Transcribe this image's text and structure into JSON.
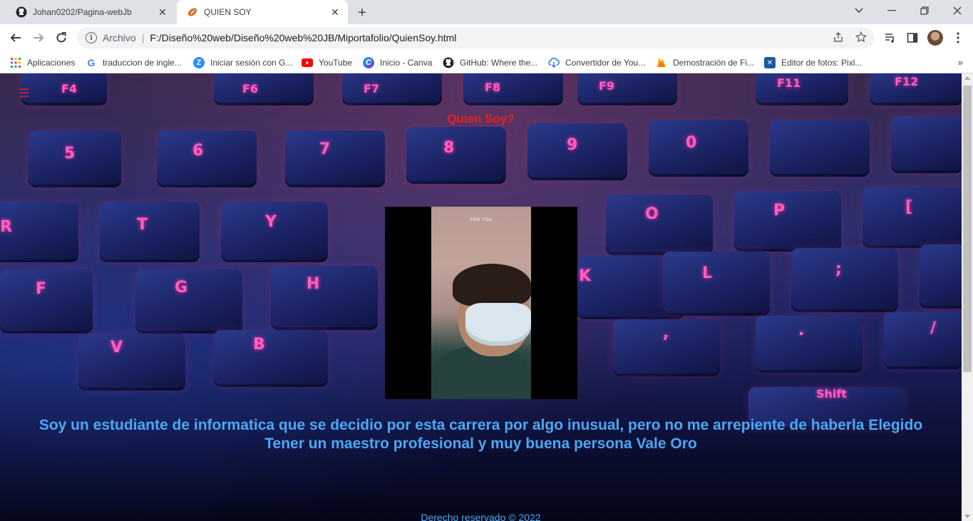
{
  "browser": {
    "tabs": [
      {
        "title": "Johan0202/Pagina-webJb",
        "icon": "github-icon",
        "active": false
      },
      {
        "title": "QUIEN SOY",
        "icon": "football-icon",
        "active": true
      }
    ],
    "new_tab_label": "+",
    "address": {
      "scheme_label": "Archivo",
      "separator": "|",
      "url": "F:/Diseño%20web/Diseño%20web%20JB/Miportafolio/QuienSoy.html"
    },
    "bookmarks": [
      {
        "label": "Aplicaciones",
        "icon": "apps-grid-icon"
      },
      {
        "label": "traduccion de ingle...",
        "icon": "google-icon"
      },
      {
        "label": "Iniciar sesión con G...",
        "icon": "zoom-icon"
      },
      {
        "label": "YouTube",
        "icon": "youtube-icon"
      },
      {
        "label": "Inicio - Canva",
        "icon": "canva-icon"
      },
      {
        "label": "GitHub: Where the...",
        "icon": "github-icon"
      },
      {
        "label": "Convertidor de You...",
        "icon": "download-cloud-icon"
      },
      {
        "label": "Demostración de Fi...",
        "icon": "firebase-icon"
      },
      {
        "label": "Editor de fotos: Pixl...",
        "icon": "pixlr-icon"
      }
    ],
    "bookmarks_more": "»"
  },
  "page": {
    "menu_icon": "☰",
    "title": "Quien Soy?",
    "photo_caption": "FOR YOU",
    "about_line1": "Soy un estudiante de informatica que se decidio por esta carrera por algo inusual, pero no me arrepiente de haberla Elegido",
    "about_line2": "Tener un maestro profesional y muy buena persona Vale Oro",
    "footer": "Derecho reservado © 2022",
    "colors": {
      "title": "#e8211d",
      "text": "#4aa8f5",
      "menu": "#e0201f"
    }
  }
}
